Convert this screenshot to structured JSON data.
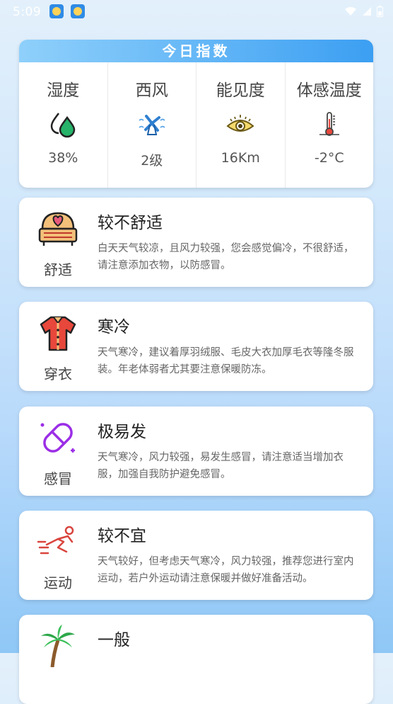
{
  "status_bar": {
    "time": "5:09"
  },
  "index_card": {
    "title": "今日指数",
    "metrics": [
      {
        "label": "湿度",
        "value": "38%",
        "icon": "humidity-drop-icon"
      },
      {
        "label": "西风",
        "value": "2级",
        "icon": "fan-icon"
      },
      {
        "label": "能见度",
        "value": "16Km",
        "icon": "eye-icon"
      },
      {
        "label": "体感温度",
        "value": "-2°C",
        "icon": "thermometer-icon"
      }
    ]
  },
  "advice": [
    {
      "category": "舒适",
      "title": "较不舒适",
      "desc": "白天天气较凉，且风力较强，您会感觉偏冷，不很舒适，请注意添加衣物，以防感冒。",
      "icon": "sofa-heart-icon"
    },
    {
      "category": "穿衣",
      "title": "寒冷",
      "desc": "天气寒冷，建议着厚羽绒服、毛皮大衣加厚毛衣等隆冬服装。年老体弱者尤其要注意保暖防冻。",
      "icon": "shirt-icon"
    },
    {
      "category": "感冒",
      "title": "极易发",
      "desc": "天气寒冷，风力较强，易发生感冒，请注意适当增加衣服，加强自我防护避免感冒。",
      "icon": "pill-icon"
    },
    {
      "category": "运动",
      "title": "较不宜",
      "desc": "天气较好，但考虑天气寒冷，风力较强，推荐您进行室内运动，若户外运动请注意保暖并做好准备活动。",
      "icon": "running-icon"
    },
    {
      "category": "",
      "title": "一般",
      "desc": "",
      "icon": "palm-tree-icon"
    }
  ],
  "colors": {
    "accent": "#3c9ff2",
    "humidity": "#27b36a",
    "pill": "#9b2ee6",
    "shirt": "#e8473b",
    "running": "#d9453d"
  }
}
